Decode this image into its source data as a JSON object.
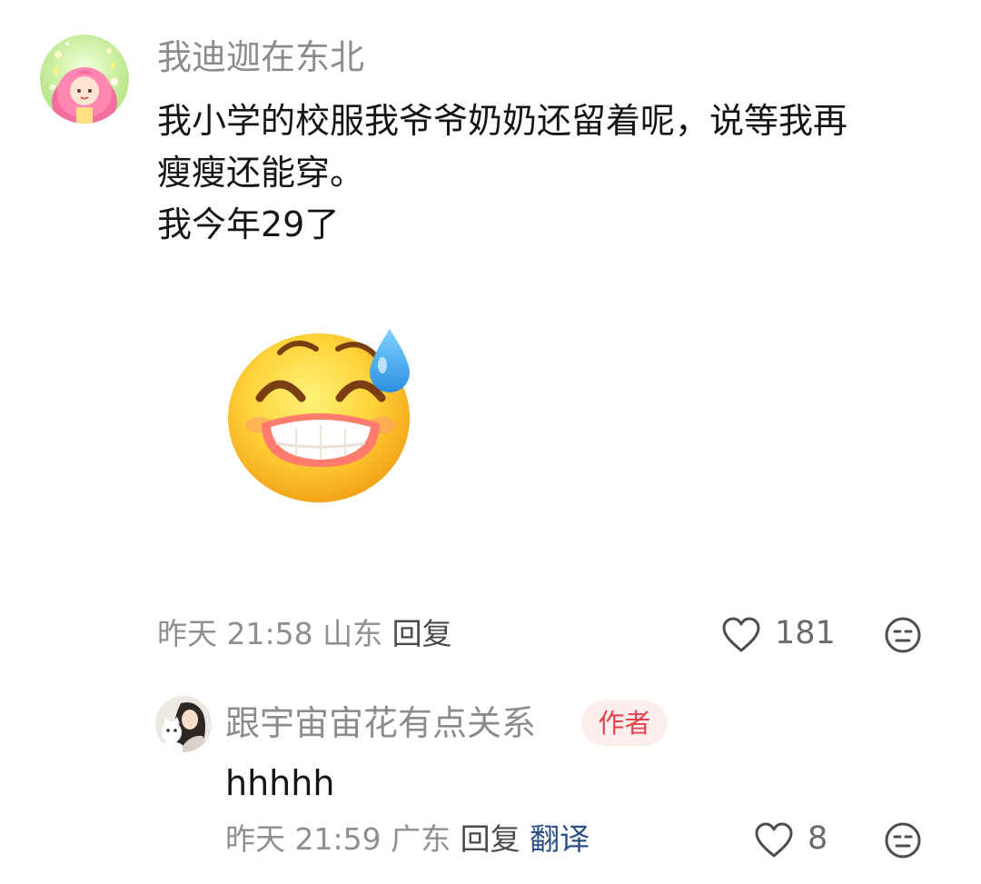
{
  "comment": {
    "username": "我迪迦在东北",
    "text_lines": [
      "我小学的校服我爷爷奶奶还留着呢，说等我再",
      "瘦瘦还能穿。",
      "我今年29了"
    ],
    "sticker": "grinning-sweat-emoji",
    "meta": {
      "date": "昨天",
      "time": "21:58",
      "location": "山东",
      "reply_label": "回复"
    },
    "like_count": "181",
    "icons": [
      "heart-icon",
      "face-reaction-icon"
    ]
  },
  "reply": {
    "username": "跟宇宙宙花有点关系",
    "author_tag": "作者",
    "text": "hhhhh",
    "meta": {
      "date": "昨天",
      "time": "21:59",
      "location": "广东",
      "reply_label": "回复",
      "translate_label": "翻译"
    },
    "like_count": "8",
    "icons": [
      "heart-icon",
      "face-reaction-icon"
    ]
  },
  "colors": {
    "username": "#8c8c8c",
    "body_text": "#151515",
    "meta": "#8f8f8f",
    "author_tag_bg": "#fdeeee",
    "author_tag_text": "#e6414b",
    "translate_link": "#2b4f86"
  }
}
